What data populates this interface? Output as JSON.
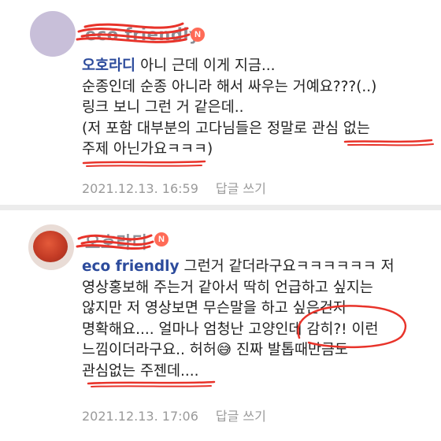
{
  "comments": [
    {
      "nickname": "eco friendly",
      "badge": "N",
      "mention": "오호라디",
      "text": "아니 근데 이게 지금...\n순종인데 순종 아니라 해서 싸우는 거예요???(..)\n링크 보니 그런 거 같은데..\n(저 포함 대부분의 고다님들은 정말로 관심 없는\n주제 아닌가요ㅋㅋㅋ)",
      "timestamp": "2021.12.13. 16:59",
      "reply_label": "답글 쓰기"
    },
    {
      "nickname": "오호라디",
      "badge": "N",
      "mention": "eco friendly",
      "text": "그런거 같더라구요ㅋㅋㅋㅋㅋㅋ 저\n영상홍보해 주는거 같아서 딱히 언급하고 싶지는\n않지만 저 영상보면 무슨말을 하고 싶은건지\n명확해요.... 얼마나 엄청난 고양인데 감히?! 이런\n느낌이더라구요.. 허허😅 진짜 발톱때만큼도\n관심없는 주젠데....",
      "timestamp": "2021.12.13. 17:06",
      "reply_label": "답글 쓰기"
    }
  ],
  "colors": {
    "mention": "#2c4b9c",
    "badge": "#ff6b57",
    "scribble": "#e8332a",
    "meta": "#9a9a9a"
  }
}
